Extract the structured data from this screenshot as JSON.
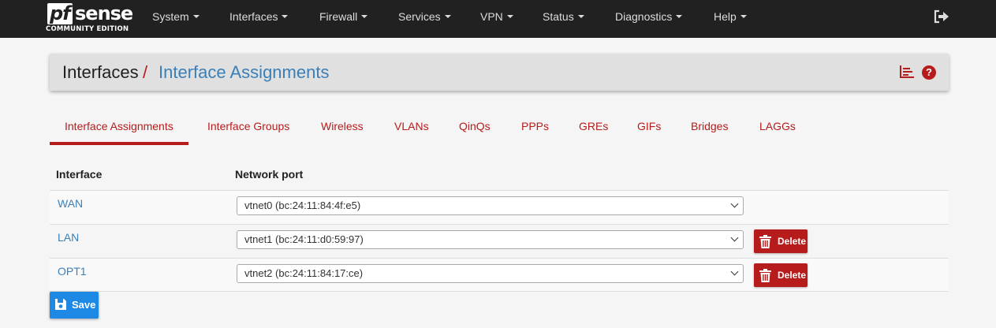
{
  "brand": {
    "pf": "pf",
    "sense": "sense",
    "edition": "COMMUNITY EDITION"
  },
  "nav": {
    "items": [
      "System",
      "Interfaces",
      "Firewall",
      "Services",
      "VPN",
      "Status",
      "Diagnostics",
      "Help"
    ],
    "logout_icon": "sign-out-icon"
  },
  "breadcrumb": {
    "root": "Interfaces",
    "separator": "/",
    "current": "Interface Assignments",
    "icons": [
      "chart-icon",
      "help-icon"
    ],
    "help_glyph": "?"
  },
  "tabs": [
    {
      "label": "Interface Assignments",
      "active": true
    },
    {
      "label": "Interface Groups",
      "active": false
    },
    {
      "label": "Wireless",
      "active": false
    },
    {
      "label": "VLANs",
      "active": false
    },
    {
      "label": "QinQs",
      "active": false
    },
    {
      "label": "PPPs",
      "active": false
    },
    {
      "label": "GREs",
      "active": false
    },
    {
      "label": "GIFs",
      "active": false
    },
    {
      "label": "Bridges",
      "active": false
    },
    {
      "label": "LAGGs",
      "active": false
    }
  ],
  "table": {
    "headers": {
      "interface": "Interface",
      "network_port": "Network port"
    },
    "rows": [
      {
        "interface": "WAN",
        "port": "vtnet0 (bc:24:11:84:4f:e5)",
        "delete": ""
      },
      {
        "interface": "LAN",
        "port": "vtnet1 (bc:24:11:d0:59:97)",
        "delete": "Delete"
      },
      {
        "interface": "OPT1",
        "port": "vtnet2 (bc:24:11:84:17:ce)",
        "delete": "Delete"
      }
    ]
  },
  "actions": {
    "save": "Save"
  },
  "colors": {
    "navbar": "#212121",
    "accent_red": "#b71c1c",
    "link_blue": "#3a7fb8",
    "save_blue": "#1e88e5"
  }
}
